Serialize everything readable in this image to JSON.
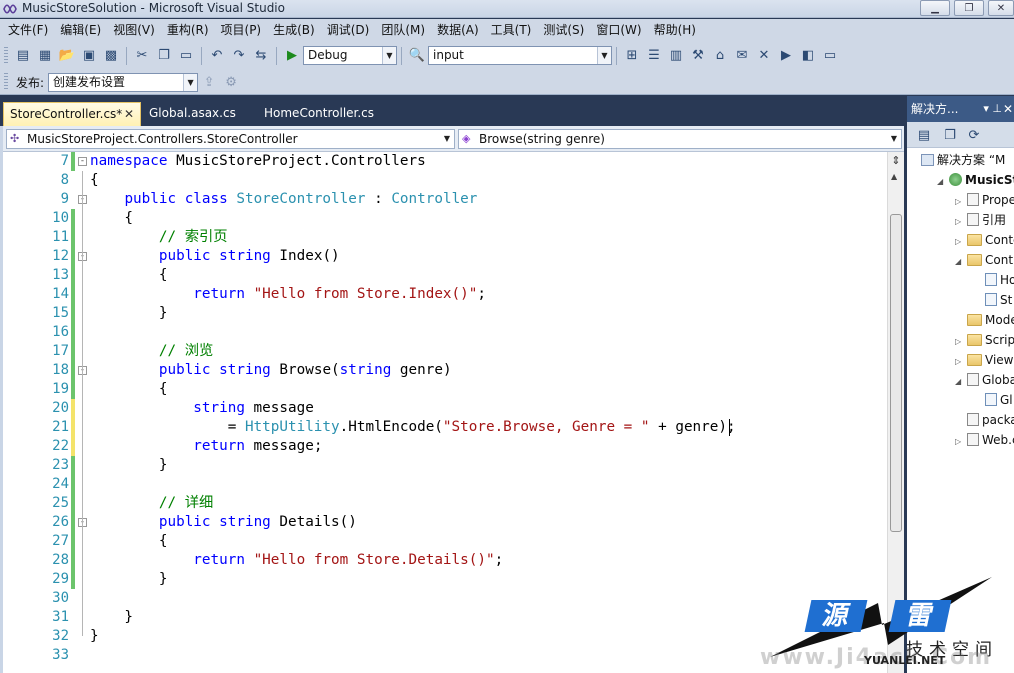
{
  "window": {
    "title": "MusicStoreSolution - Microsoft Visual Studio",
    "buttons": [
      "▁",
      "❐",
      "✕"
    ]
  },
  "menu": [
    "文件(F)",
    "编辑(E)",
    "视图(V)",
    "重构(R)",
    "项目(P)",
    "生成(B)",
    "调试(D)",
    "团队(M)",
    "数据(A)",
    "工具(T)",
    "测试(S)",
    "窗口(W)",
    "帮助(H)"
  ],
  "toolbar": {
    "config": "Debug",
    "find": "input",
    "publish_label": "发布:",
    "publish_profile": "创建发布设置"
  },
  "tabs": [
    {
      "label": "StoreController.cs*",
      "active": true
    },
    {
      "label": "Global.asax.cs",
      "active": false
    },
    {
      "label": "HomeController.cs",
      "active": false
    }
  ],
  "navigation": {
    "type": "MusicStoreProject.Controllers.StoreController",
    "member": "Browse(string genre)"
  },
  "code_lines": [
    {
      "n": "7",
      "c": "green",
      "fold": "-",
      "text": "namespace MusicStoreProject.Controllers"
    },
    {
      "n": "8",
      "c": "",
      "fold": "",
      "text": "{"
    },
    {
      "n": "9",
      "c": "",
      "fold": "-",
      "text": "    public class StoreController : Controller"
    },
    {
      "n": "10",
      "c": "green",
      "fold": "",
      "text": "    {"
    },
    {
      "n": "11",
      "c": "green",
      "fold": "",
      "text": "        // 索引页"
    },
    {
      "n": "12",
      "c": "green",
      "fold": "-",
      "text": "        public string Index()"
    },
    {
      "n": "13",
      "c": "green",
      "fold": "",
      "text": "        {"
    },
    {
      "n": "14",
      "c": "green",
      "fold": "",
      "text": "            return \"Hello from Store.Index()\";"
    },
    {
      "n": "15",
      "c": "green",
      "fold": "",
      "text": "        }"
    },
    {
      "n": "16",
      "c": "green",
      "fold": "",
      "text": ""
    },
    {
      "n": "17",
      "c": "green",
      "fold": "",
      "text": "        // 浏览"
    },
    {
      "n": "18",
      "c": "green",
      "fold": "-",
      "text": "        public string Browse(string genre)"
    },
    {
      "n": "19",
      "c": "green",
      "fold": "",
      "text": "        {"
    },
    {
      "n": "20",
      "c": "yellow",
      "fold": "",
      "text": "            string message"
    },
    {
      "n": "21",
      "c": "yellow",
      "fold": "",
      "text": "                = HttpUtility.HtmlEncode(\"Store.Browse, Genre = \" + genre);"
    },
    {
      "n": "22",
      "c": "yellow",
      "fold": "",
      "text": "            return message;"
    },
    {
      "n": "23",
      "c": "green",
      "fold": "",
      "text": "        }"
    },
    {
      "n": "24",
      "c": "green",
      "fold": "",
      "text": ""
    },
    {
      "n": "25",
      "c": "green",
      "fold": "",
      "text": "        // 详细"
    },
    {
      "n": "26",
      "c": "green",
      "fold": "-",
      "text": "        public string Details()"
    },
    {
      "n": "27",
      "c": "green",
      "fold": "",
      "text": "        {"
    },
    {
      "n": "28",
      "c": "green",
      "fold": "",
      "text": "            return \"Hello from Store.Details()\";"
    },
    {
      "n": "29",
      "c": "green",
      "fold": "",
      "text": "        }"
    },
    {
      "n": "30",
      "c": "",
      "fold": "",
      "text": ""
    },
    {
      "n": "31",
      "c": "",
      "fold": "",
      "text": "    }"
    },
    {
      "n": "32",
      "c": "",
      "fold": "",
      "text": "}"
    },
    {
      "n": "33",
      "c": "",
      "fold": "",
      "text": ""
    }
  ],
  "solution_explorer": {
    "title": "解决方...",
    "items": [
      {
        "label": "解决方案 “M",
        "indent": 0,
        "exp": "",
        "icon": "sol"
      },
      {
        "label": "MusicSto",
        "indent": 1,
        "exp": "◢",
        "icon": "proj",
        "bold": true
      },
      {
        "label": "Prope",
        "indent": 2,
        "exp": "▷",
        "icon": "file"
      },
      {
        "label": "引用",
        "indent": 2,
        "exp": "▷",
        "icon": "file"
      },
      {
        "label": "Conte",
        "indent": 2,
        "exp": "▷",
        "icon": "folder"
      },
      {
        "label": "Contr",
        "indent": 2,
        "exp": "◢",
        "icon": "folder"
      },
      {
        "label": "Ho",
        "indent": 3,
        "exp": "",
        "icon": "cs"
      },
      {
        "label": "St",
        "indent": 3,
        "exp": "",
        "icon": "cs"
      },
      {
        "label": "Mode",
        "indent": 2,
        "exp": "",
        "icon": "folder"
      },
      {
        "label": "Script",
        "indent": 2,
        "exp": "▷",
        "icon": "folder"
      },
      {
        "label": "Views",
        "indent": 2,
        "exp": "▷",
        "icon": "folder"
      },
      {
        "label": "Globa",
        "indent": 2,
        "exp": "◢",
        "icon": "file"
      },
      {
        "label": "Gl",
        "indent": 3,
        "exp": "",
        "icon": "cs"
      },
      {
        "label": "packa",
        "indent": 2,
        "exp": "",
        "icon": "file"
      },
      {
        "label": "Web.c",
        "indent": 2,
        "exp": "▷",
        "icon": "file"
      }
    ]
  },
  "watermark": {
    "char1": "源",
    "char2": "雷",
    "tagline": "技术空间",
    "site": "YUANLEI.NET",
    "faint": "www.Ji4ack.Com"
  },
  "colors": {
    "keyword": "#0000ff",
    "type": "#2b91af",
    "string": "#a31515",
    "comment": "#008000",
    "changed_saved": "#6cc46c",
    "changed_unsaved": "#f4e36a"
  }
}
